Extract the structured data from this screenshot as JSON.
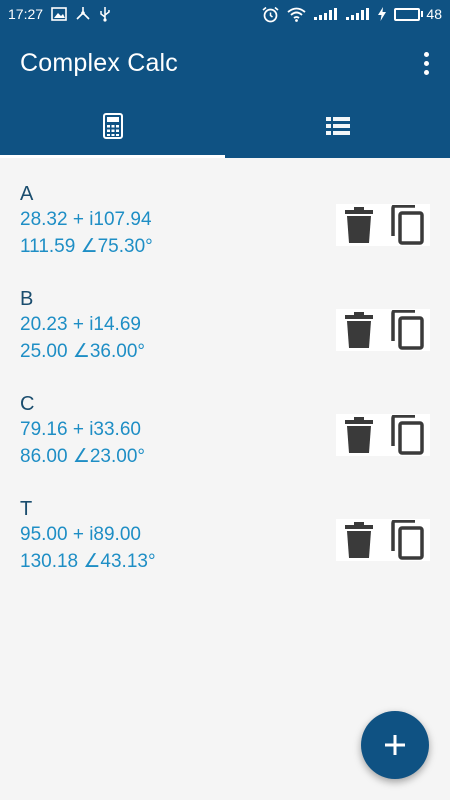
{
  "status_bar": {
    "time": "17:27",
    "battery_level": "48",
    "left_icons": [
      "image-icon",
      "usb-share-icon",
      "usb-icon"
    ],
    "right_icons": [
      "alarm-icon",
      "wifi-icon",
      "signal-icon",
      "signal-icon",
      "charging-icon"
    ]
  },
  "app_bar": {
    "title": "Complex Calc",
    "menu_icon": "more-vert-icon"
  },
  "tabs": [
    {
      "icon": "calculator-icon",
      "active": true
    },
    {
      "icon": "list-icon",
      "active": false
    }
  ],
  "entries": [
    {
      "name": "A",
      "rect": "28.32 + i107.94",
      "polar": "111.59 ∠75.30°"
    },
    {
      "name": "B",
      "rect": "20.23 + i14.69",
      "polar": "25.00 ∠36.00°"
    },
    {
      "name": "C",
      "rect": "79.16 + i33.60",
      "polar": "86.00 ∠23.00°"
    },
    {
      "name": "T",
      "rect": "95.00 + i89.00",
      "polar": "130.18 ∠43.13°"
    }
  ],
  "fab": {
    "label": "+",
    "icon": "add-icon"
  },
  "colors": {
    "primary": "#0f5283",
    "name_text": "#1a4d6e",
    "value_text": "#1e8ec5",
    "action_icon": "#3a3a3a",
    "background": "#f5f5f5"
  }
}
